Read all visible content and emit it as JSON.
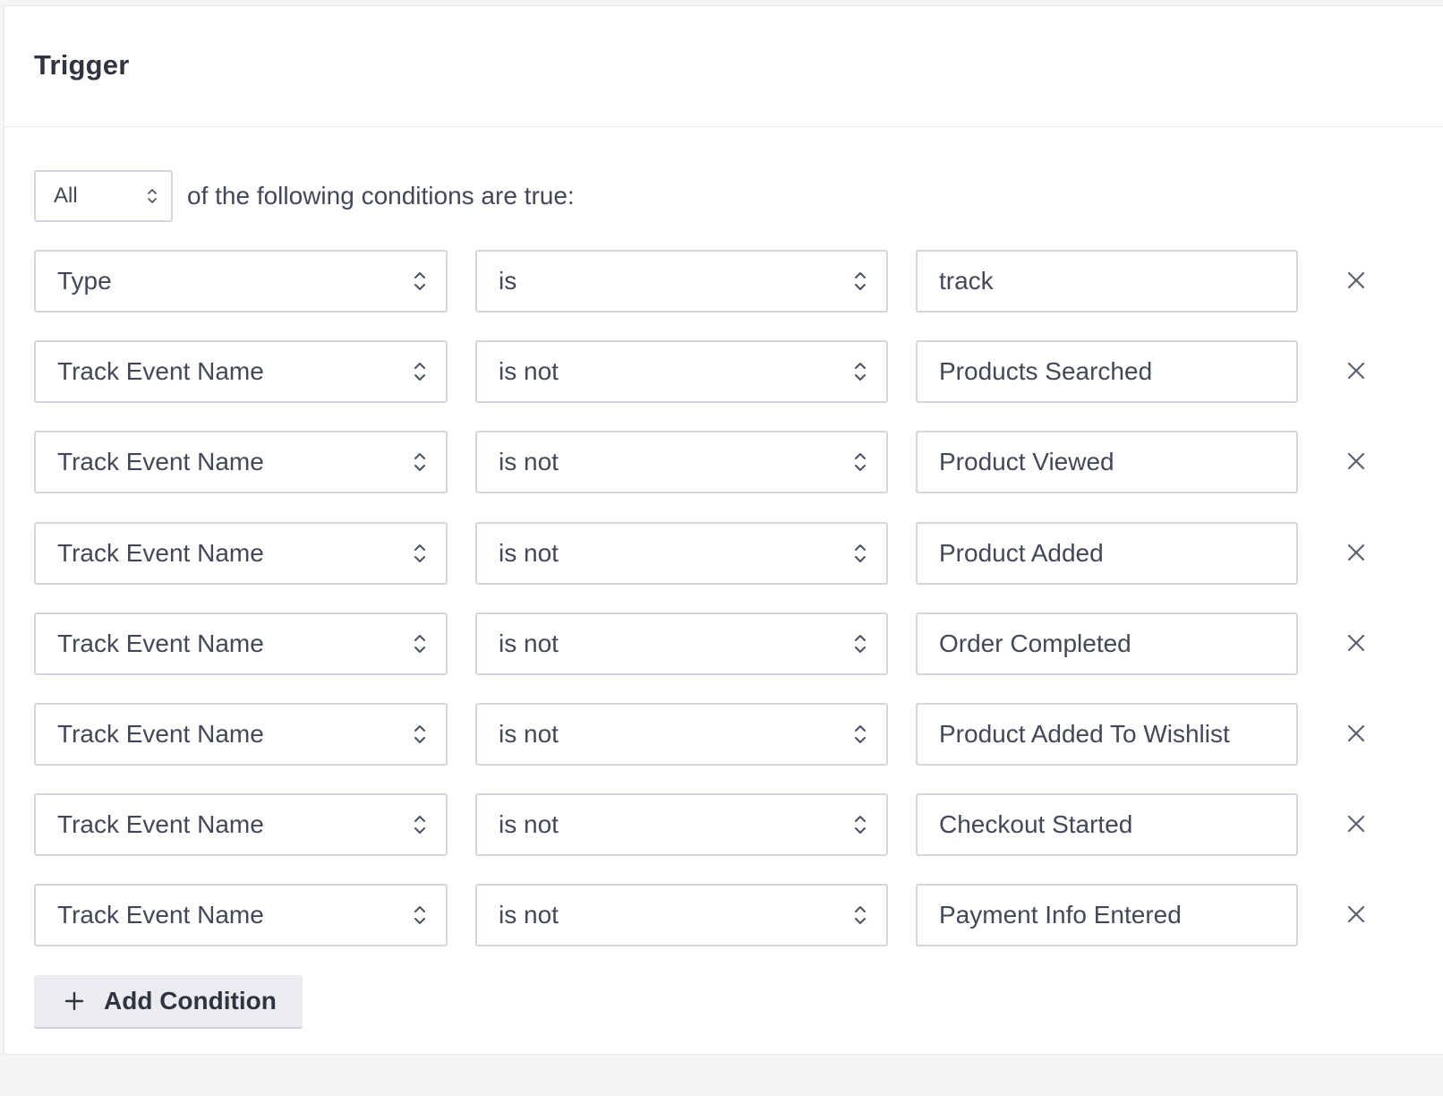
{
  "trigger": {
    "title": "Trigger",
    "match": {
      "selected": "All",
      "text": "of the following conditions are true:"
    },
    "conditions": [
      {
        "field": "Type",
        "operator": "is",
        "value": "track"
      },
      {
        "field": "Track Event Name",
        "operator": "is not",
        "value": "Products Searched"
      },
      {
        "field": "Track Event Name",
        "operator": "is not",
        "value": "Product Viewed"
      },
      {
        "field": "Track Event Name",
        "operator": "is not",
        "value": "Product Added"
      },
      {
        "field": "Track Event Name",
        "operator": "is not",
        "value": "Order Completed"
      },
      {
        "field": "Track Event Name",
        "operator": "is not",
        "value": "Product Added To Wishlist"
      },
      {
        "field": "Track Event Name",
        "operator": "is not",
        "value": "Checkout Started"
      },
      {
        "field": "Track Event Name",
        "operator": "is not",
        "value": "Payment Info Entered"
      }
    ],
    "add_button_label": "Add Condition"
  },
  "icons": {
    "select_caret": "chevron-up-down-icon",
    "remove": "close-icon",
    "add": "plus-icon"
  },
  "colors": {
    "border": "#d3d6dc",
    "text": "#424857",
    "title": "#2f3440",
    "button_bg": "#ebecf0"
  }
}
